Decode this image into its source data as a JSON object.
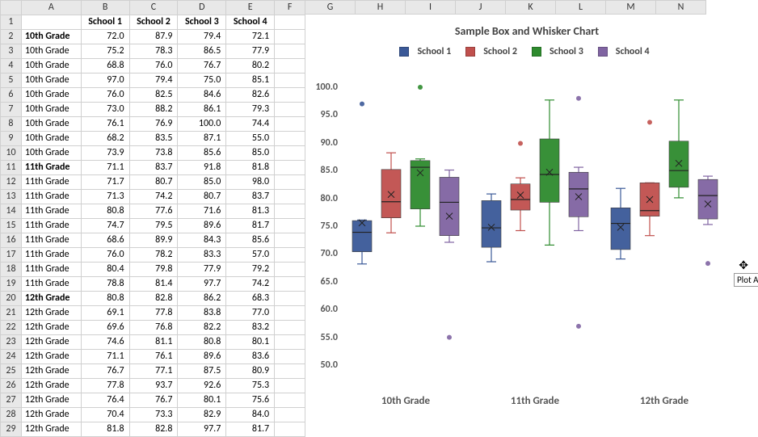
{
  "columns": [
    "A",
    "B",
    "C",
    "D",
    "E",
    "F",
    "G",
    "H",
    "I",
    "J",
    "K",
    "L",
    "M",
    "N"
  ],
  "table_headers": [
    "",
    "School 1",
    "School 2",
    "School 3",
    "School 4"
  ],
  "rows": [
    {
      "n": 2,
      "label": "10th Grade",
      "bold": true,
      "v": [
        72.0,
        87.9,
        79.4,
        72.1
      ]
    },
    {
      "n": 3,
      "label": "10th Grade",
      "v": [
        75.2,
        78.3,
        86.5,
        77.9
      ]
    },
    {
      "n": 4,
      "label": "10th Grade",
      "v": [
        68.8,
        76.0,
        76.7,
        80.2
      ]
    },
    {
      "n": 5,
      "label": "10th Grade",
      "v": [
        97.0,
        79.4,
        75.0,
        85.1
      ]
    },
    {
      "n": 6,
      "label": "10th Grade",
      "v": [
        76.0,
        82.5,
        84.6,
        82.6
      ]
    },
    {
      "n": 7,
      "label": "10th Grade",
      "v": [
        73.0,
        88.2,
        86.1,
        79.3
      ]
    },
    {
      "n": 8,
      "label": "10th Grade",
      "v": [
        76.1,
        76.9,
        100.0,
        74.4
      ]
    },
    {
      "n": 9,
      "label": "10th Grade",
      "v": [
        68.2,
        83.5,
        87.1,
        55.0
      ]
    },
    {
      "n": 10,
      "label": "10th Grade",
      "v": [
        73.9,
        73.8,
        85.6,
        85.0
      ]
    },
    {
      "n": 11,
      "label": "11th Grade",
      "bold": true,
      "v": [
        71.1,
        83.7,
        91.8,
        81.8
      ]
    },
    {
      "n": 12,
      "label": "11th Grade",
      "v": [
        71.7,
        80.7,
        85.0,
        98.0
      ]
    },
    {
      "n": 13,
      "label": "11th Grade",
      "v": [
        71.3,
        74.2,
        80.7,
        83.7
      ]
    },
    {
      "n": 14,
      "label": "11th Grade",
      "v": [
        80.8,
        77.6,
        71.6,
        81.3
      ]
    },
    {
      "n": 15,
      "label": "11th Grade",
      "v": [
        74.7,
        79.5,
        89.6,
        81.7
      ]
    },
    {
      "n": 16,
      "label": "11th Grade",
      "v": [
        68.6,
        89.9,
        84.3,
        85.6
      ]
    },
    {
      "n": 17,
      "label": "11th Grade",
      "v": [
        76.0,
        78.2,
        83.3,
        57.0
      ]
    },
    {
      "n": 18,
      "label": "11th Grade",
      "v": [
        80.4,
        79.8,
        77.9,
        79.2
      ]
    },
    {
      "n": 19,
      "label": "11th Grade",
      "v": [
        78.8,
        81.4,
        97.7,
        74.2
      ]
    },
    {
      "n": 20,
      "label": "12th Grade",
      "bold": true,
      "v": [
        80.8,
        82.8,
        86.2,
        68.3
      ]
    },
    {
      "n": 21,
      "label": "12th Grade",
      "v": [
        69.1,
        77.8,
        83.8,
        77.0
      ]
    },
    {
      "n": 22,
      "label": "12th Grade",
      "v": [
        69.6,
        76.8,
        82.2,
        83.2
      ]
    },
    {
      "n": 23,
      "label": "12th Grade",
      "v": [
        74.6,
        81.1,
        80.8,
        80.1
      ]
    },
    {
      "n": 24,
      "label": "12th Grade",
      "v": [
        71.1,
        76.1,
        89.6,
        83.6
      ]
    },
    {
      "n": 25,
      "label": "12th Grade",
      "v": [
        76.7,
        77.1,
        87.5,
        80.9
      ]
    },
    {
      "n": 26,
      "label": "12th Grade",
      "v": [
        77.8,
        93.7,
        92.6,
        75.3
      ]
    },
    {
      "n": 27,
      "label": "12th Grade",
      "v": [
        76.4,
        76.7,
        80.1,
        75.6
      ]
    },
    {
      "n": 28,
      "label": "12th Grade",
      "v": [
        70.4,
        73.3,
        82.9,
        84.0
      ]
    },
    {
      "n": 29,
      "label": "12th Grade",
      "v": [
        81.8,
        82.8,
        97.7,
        81.7
      ]
    }
  ],
  "chart_title": "Sample Box and Whisker Chart",
  "legend": [
    {
      "name": "School 1",
      "color": "#3b5998"
    },
    {
      "name": "School 2",
      "color": "#c0504d"
    },
    {
      "name": "School 3",
      "color": "#2e8b2e"
    },
    {
      "name": "School 4",
      "color": "#8064a2"
    }
  ],
  "tooltip_text": "Plot Ar",
  "chart_data": {
    "type": "boxplot",
    "title": "Sample Box and Whisker Chart",
    "ylabel": "",
    "ylim": [
      50.0,
      100.0
    ],
    "yticks": [
      50.0,
      55.0,
      60.0,
      65.0,
      70.0,
      75.0,
      80.0,
      85.0,
      90.0,
      95.0,
      100.0
    ],
    "categories": [
      "10th Grade",
      "11th Grade",
      "12th Grade"
    ],
    "series": [
      {
        "name": "School 1",
        "color": "#3b5998",
        "boxes": [
          {
            "min": 68.2,
            "q1": 70.4,
            "median": 73.9,
            "q3": 76.0,
            "max": 76.1,
            "mean": 75.6,
            "outliers": [
              97.0
            ]
          },
          {
            "min": 68.6,
            "q1": 71.2,
            "median": 74.7,
            "q3": 79.6,
            "max": 80.8,
            "mean": 74.8,
            "outliers": []
          },
          {
            "min": 69.1,
            "q1": 70.8,
            "median": 75.5,
            "q3": 78.3,
            "max": 81.8,
            "mean": 74.8,
            "outliers": []
          }
        ]
      },
      {
        "name": "School 2",
        "color": "#c0504d",
        "boxes": [
          {
            "min": 73.8,
            "q1": 76.5,
            "median": 79.4,
            "q3": 85.2,
            "max": 88.2,
            "mean": 80.7,
            "outliers": []
          },
          {
            "min": 74.2,
            "q1": 77.9,
            "median": 79.8,
            "q3": 82.6,
            "max": 83.7,
            "mean": 80.6,
            "outliers": [
              89.9
            ]
          },
          {
            "min": 73.3,
            "q1": 76.8,
            "median": 77.8,
            "q3": 82.8,
            "max": 82.8,
            "mean": 79.8,
            "outliers": [
              93.7
            ]
          }
        ]
      },
      {
        "name": "School 3",
        "color": "#2e8b2e",
        "boxes": [
          {
            "min": 75.0,
            "q1": 78.1,
            "median": 85.6,
            "q3": 86.8,
            "max": 87.1,
            "mean": 84.6,
            "outliers": [
              100.0
            ]
          },
          {
            "min": 71.6,
            "q1": 79.3,
            "median": 84.3,
            "q3": 90.7,
            "max": 97.7,
            "mean": 84.7,
            "outliers": []
          },
          {
            "min": 80.1,
            "q1": 82.0,
            "median": 85.0,
            "q3": 90.3,
            "max": 97.7,
            "mean": 86.3,
            "outliers": []
          }
        ]
      },
      {
        "name": "School 4",
        "color": "#8064a2",
        "boxes": [
          {
            "min": 72.1,
            "q1": 73.3,
            "median": 79.3,
            "q3": 83.8,
            "max": 85.1,
            "mean": 76.8,
            "outliers": [
              55.0
            ]
          },
          {
            "min": 74.2,
            "q1": 76.7,
            "median": 81.7,
            "q3": 84.7,
            "max": 85.6,
            "mean": 80.3,
            "outliers": [
              98.0,
              57.0
            ]
          },
          {
            "min": 75.3,
            "q1": 76.3,
            "median": 80.5,
            "q3": 83.4,
            "max": 84.0,
            "mean": 79.0,
            "outliers": [
              68.3
            ]
          }
        ]
      }
    ]
  }
}
